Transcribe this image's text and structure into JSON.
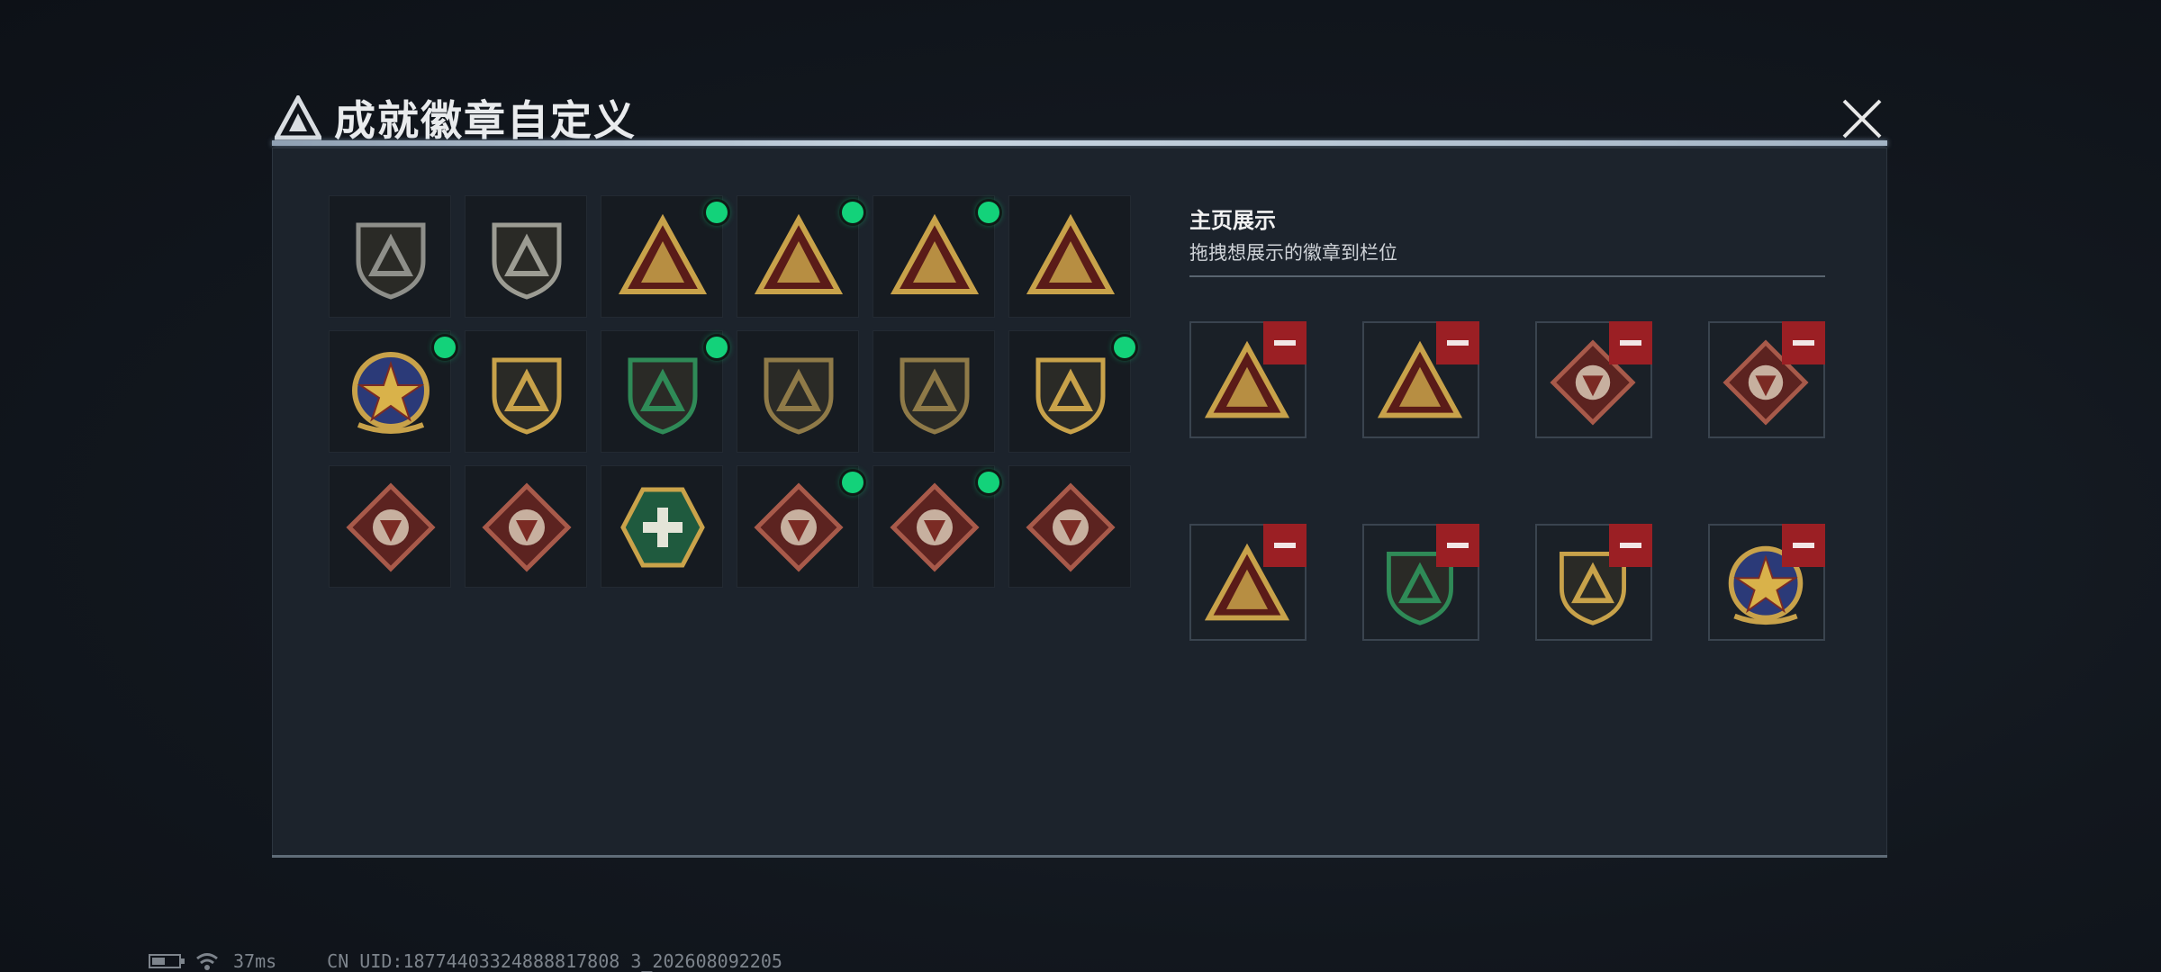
{
  "header": {
    "title": "成就徽章自定义",
    "close_icon": "close-icon"
  },
  "badges": [
    {
      "icon": "shield-triangle-icon",
      "frame": "shield",
      "color": "#8e8f8a",
      "selected": false
    },
    {
      "icon": "helicopter-icon",
      "frame": "shield",
      "color": "#9c9c93",
      "selected": false
    },
    {
      "icon": "boat-triangle-icon",
      "frame": "triangle",
      "color": "#c8a24a",
      "selected": true
    },
    {
      "icon": "number-one-triangle-icon",
      "frame": "triangle",
      "color": "#c8a24a",
      "selected": true
    },
    {
      "icon": "tower-triangle-icon",
      "frame": "triangle",
      "color": "#c8a24a",
      "selected": true
    },
    {
      "icon": "soldiers-triangle-icon",
      "frame": "triangle",
      "color": "#c8a24a",
      "selected": false
    },
    {
      "icon": "star-medal-icon",
      "frame": "round",
      "color": "#c8a24a",
      "selected": true
    },
    {
      "icon": "wing-shield-icon",
      "frame": "shield",
      "color": "#c8a24a",
      "selected": false
    },
    {
      "icon": "diamond-beret-icon",
      "frame": "shield",
      "color": "#2f8a57",
      "selected": true
    },
    {
      "icon": "rifle-shield-icon",
      "frame": "shield",
      "color": "#8f7a48",
      "selected": false
    },
    {
      "icon": "rifle-shield-icon",
      "frame": "shield",
      "color": "#8f7a48",
      "selected": false
    },
    {
      "icon": "anchor-crest-icon",
      "frame": "shield",
      "color": "#c8a24a",
      "selected": true
    },
    {
      "icon": "wolf-diamond-icon",
      "frame": "diamond",
      "color": "#a85a4a",
      "selected": false
    },
    {
      "icon": "wolf-diamond-icon",
      "frame": "diamond",
      "color": "#a85a4a",
      "selected": false
    },
    {
      "icon": "medic-hexagon-icon",
      "frame": "hexagon",
      "color": "#3c8a62",
      "selected": false
    },
    {
      "icon": "dragon-diamond-icon",
      "frame": "diamond",
      "color": "#a85a4a",
      "selected": true
    },
    {
      "icon": "dragon-diamond-icon",
      "frame": "diamond",
      "color": "#a85a4a",
      "selected": true
    },
    {
      "icon": "runner-diamond-icon",
      "frame": "diamond",
      "color": "#a85a4a",
      "selected": false
    }
  ],
  "showcase": {
    "title": "主页展示",
    "subtitle": "拖拽想展示的徽章到栏位",
    "remove_icon": "minus-icon",
    "slots": [
      {
        "icon": "number-one-triangle-icon",
        "frame": "triangle",
        "color": "#c8a24a"
      },
      {
        "icon": "tower-triangle-icon",
        "frame": "triangle",
        "color": "#c8a24a"
      },
      {
        "icon": "dragon-diamond-icon",
        "frame": "diamond",
        "color": "#a85a4a"
      },
      {
        "icon": "dragon-diamond-icon",
        "frame": "diamond",
        "color": "#a85a4a"
      },
      {
        "icon": "boat-triangle-icon",
        "frame": "triangle",
        "color": "#c8a24a"
      },
      {
        "icon": "diamond-beret-icon",
        "frame": "shield",
        "color": "#2f8a57"
      },
      {
        "icon": "anchor-crest-icon",
        "frame": "shield",
        "color": "#c8a24a"
      },
      {
        "icon": "star-medal-icon",
        "frame": "round",
        "color": "#c8a24a"
      }
    ]
  },
  "status_bar": {
    "battery_icon": "battery-icon",
    "wifi_icon": "wifi-icon",
    "ping": "37ms",
    "uid": "CN UID:18774403324888817808 3_202608092205"
  },
  "colors": {
    "selected_dot": "#13d27a",
    "remove_button": "#9b1f24",
    "panel": "#1c232c"
  }
}
